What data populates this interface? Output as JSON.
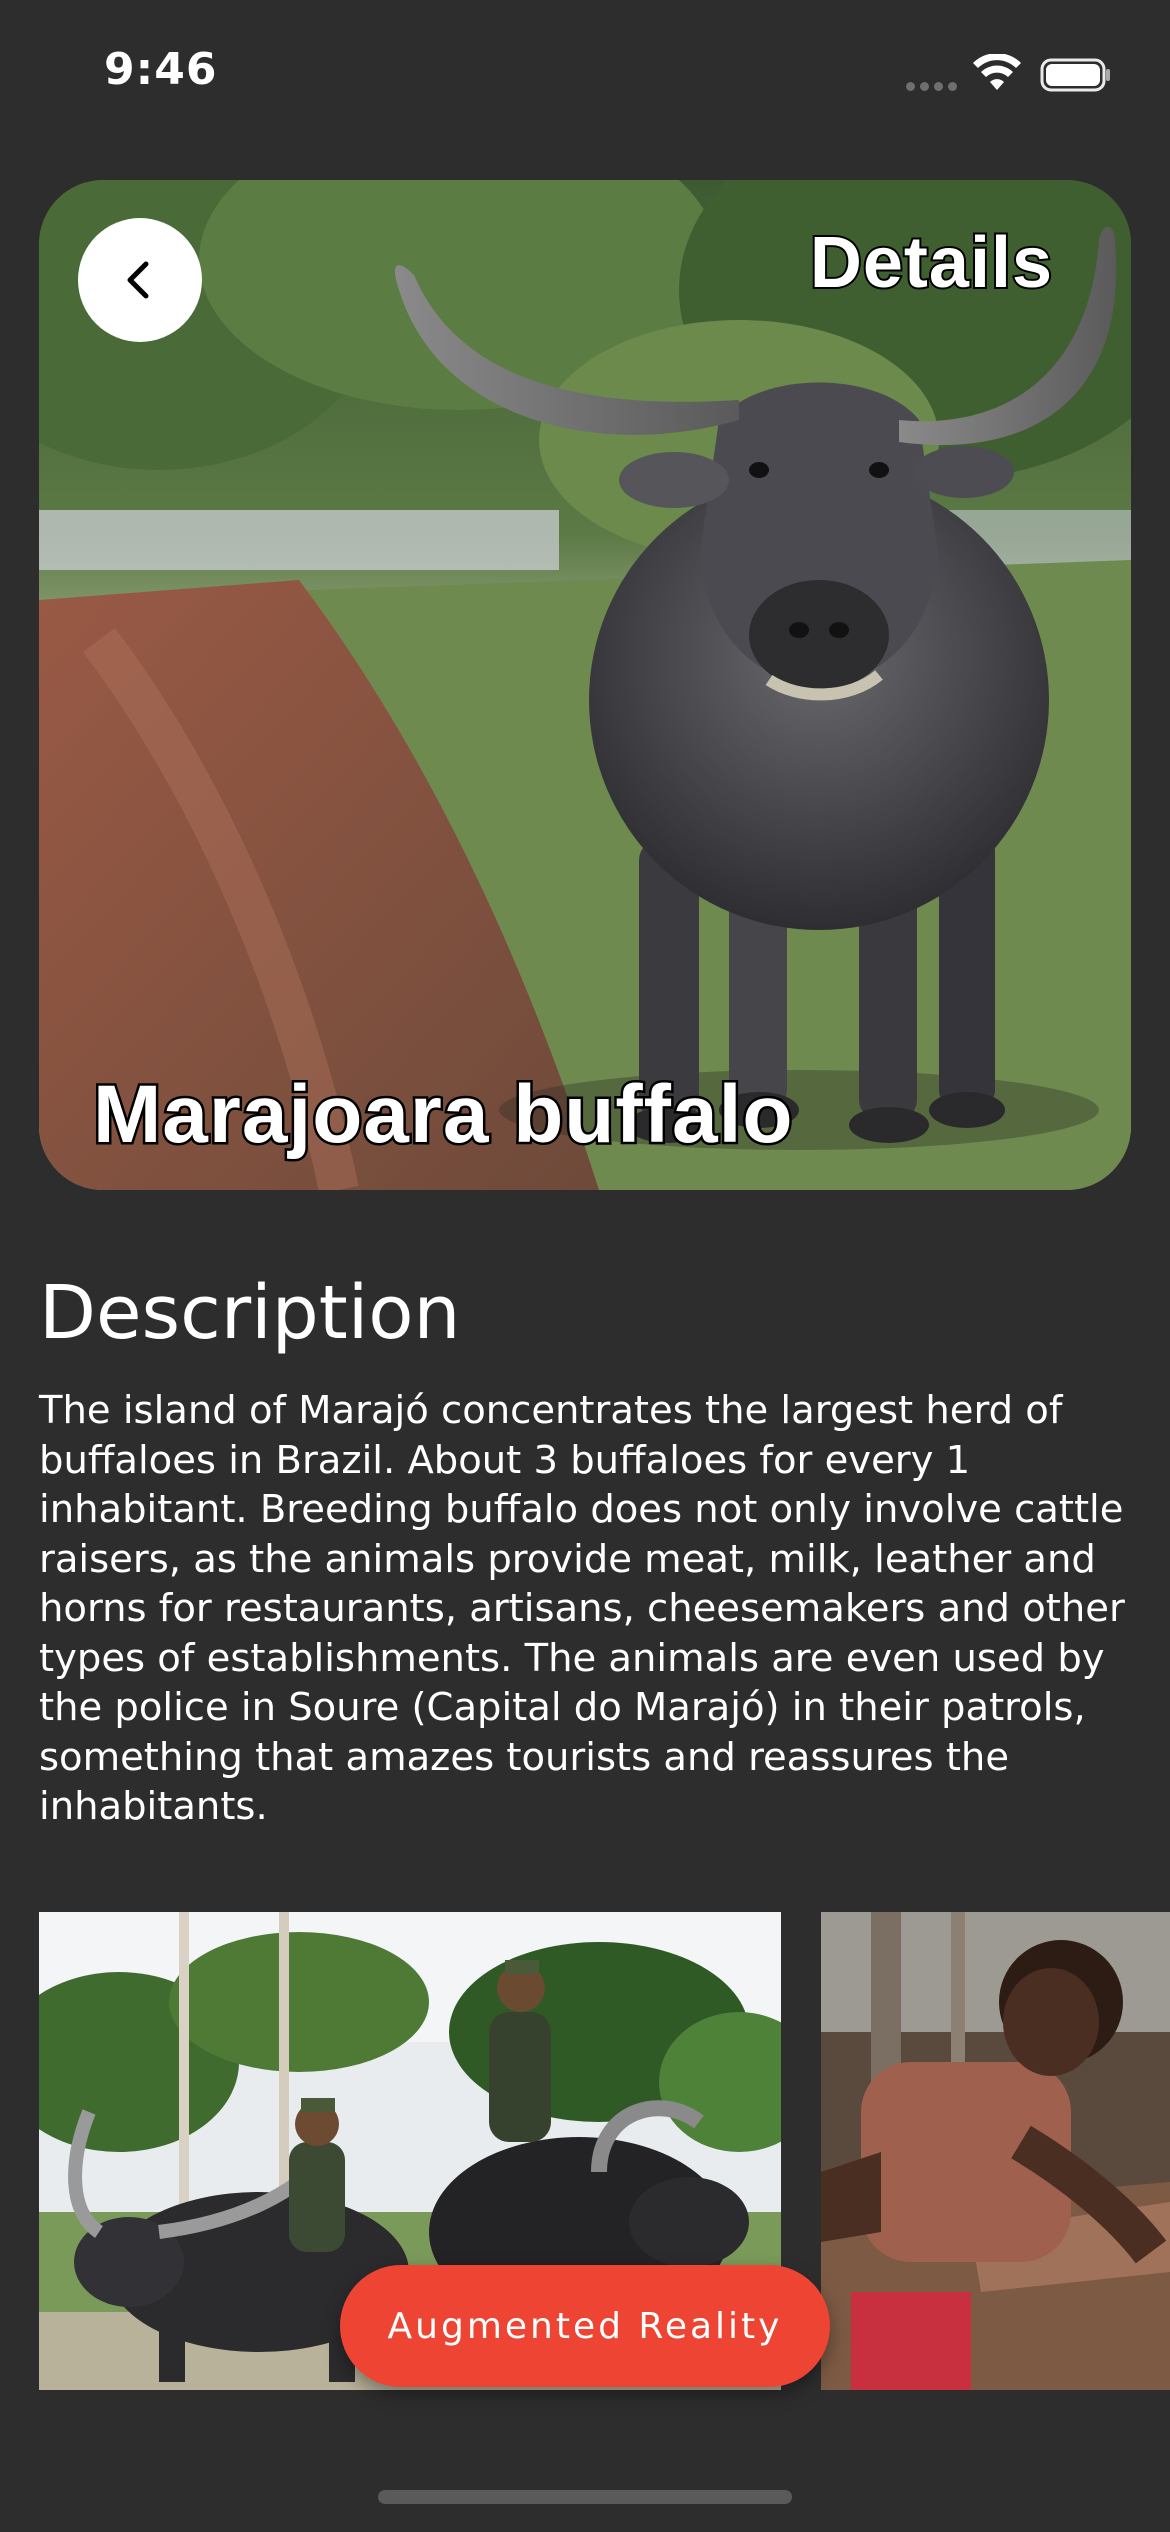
{
  "status_bar": {
    "time": "9:46",
    "icons": [
      "cellular-signal-icon",
      "wifi-icon",
      "battery-icon"
    ]
  },
  "header": {
    "title": "Details",
    "back_icon": "chevron-left-icon"
  },
  "hero": {
    "title": "Marajoara buffalo",
    "image": "buffalo-photo"
  },
  "description": {
    "heading": "Description",
    "text": "The island of Marajó concentrates the largest herd of buffaloes in Brazil. About 3 buffaloes for every 1 inhabitant. Breeding buffalo does not only involve cattle raisers, as the animals provide meat, milk, leather and horns for restaurants, artisans, cheesemakers and other types of establishments. The animals are even used by the police in Soure (Capital do Marajó) in their patrols, something that amazes tourists and reassures the inhabitants."
  },
  "gallery": {
    "items": [
      "police-on-buffaloes-photo",
      "artisan-working-leather-photo"
    ]
  },
  "actions": {
    "ar_label": "Augmented Reality"
  },
  "colors": {
    "background": "#2d2d2d",
    "accent": "#ee4433",
    "text": "#ffffff"
  }
}
